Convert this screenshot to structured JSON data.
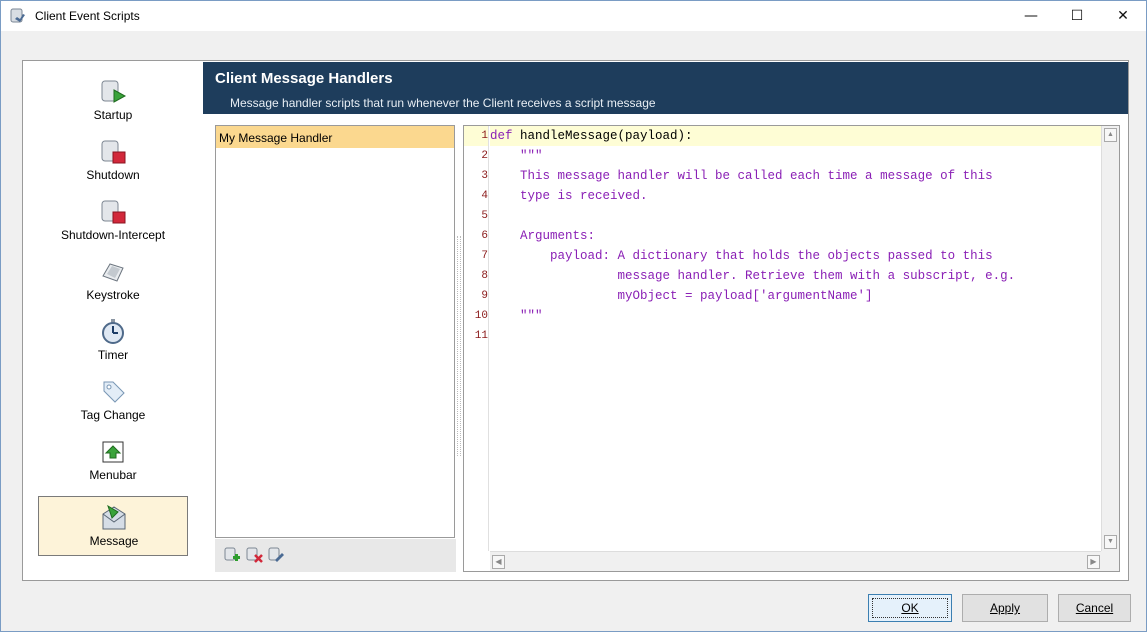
{
  "window": {
    "title": "Client Event Scripts",
    "minimize_symbol": "—",
    "maximize_symbol": "☐",
    "close_symbol": "✕"
  },
  "sidebar": {
    "items": [
      {
        "label": "Startup",
        "icon": "startup-icon"
      },
      {
        "label": "Shutdown",
        "icon": "shutdown-icon"
      },
      {
        "label": "Shutdown-Intercept",
        "icon": "shutdown-intercept-icon"
      },
      {
        "label": "Keystroke",
        "icon": "keyboard-icon"
      },
      {
        "label": "Timer",
        "icon": "stopwatch-icon"
      },
      {
        "label": "Tag Change",
        "icon": "tag-icon"
      },
      {
        "label": "Menubar",
        "icon": "menubar-icon"
      },
      {
        "label": "Message",
        "icon": "message-icon",
        "selected": true
      }
    ]
  },
  "header": {
    "title": "Client Message Handlers",
    "subtitle": "Message handler scripts that run whenever the Client receives a script message"
  },
  "handlers": {
    "items": [
      "My Message Handler"
    ]
  },
  "editor": {
    "lines": [
      {
        "num": "1",
        "text": "def handleMessage(payload):"
      },
      {
        "num": "2",
        "text": "    \"\"\""
      },
      {
        "num": "3",
        "text": "    This message handler will be called each time a message of this"
      },
      {
        "num": "4",
        "text": "    type is received."
      },
      {
        "num": "5",
        "text": ""
      },
      {
        "num": "6",
        "text": "    Arguments:"
      },
      {
        "num": "7",
        "text": "        payload: A dictionary that holds the objects passed to this"
      },
      {
        "num": "8",
        "text": "                 message handler. Retrieve them with a subscript, e.g."
      },
      {
        "num": "9",
        "text": "                 myObject = payload['argumentName']"
      },
      {
        "num": "10",
        "text": "    \"\"\""
      },
      {
        "num": "11",
        "text": ""
      }
    ]
  },
  "buttons": {
    "ok": "OK",
    "apply": "Apply",
    "cancel": "Cancel"
  },
  "colors": {
    "header_bg": "#1e3d5c",
    "selected_handler": "#fbd88f",
    "code_text": "#8a1fb5",
    "line_number": "#8a1a1a"
  }
}
